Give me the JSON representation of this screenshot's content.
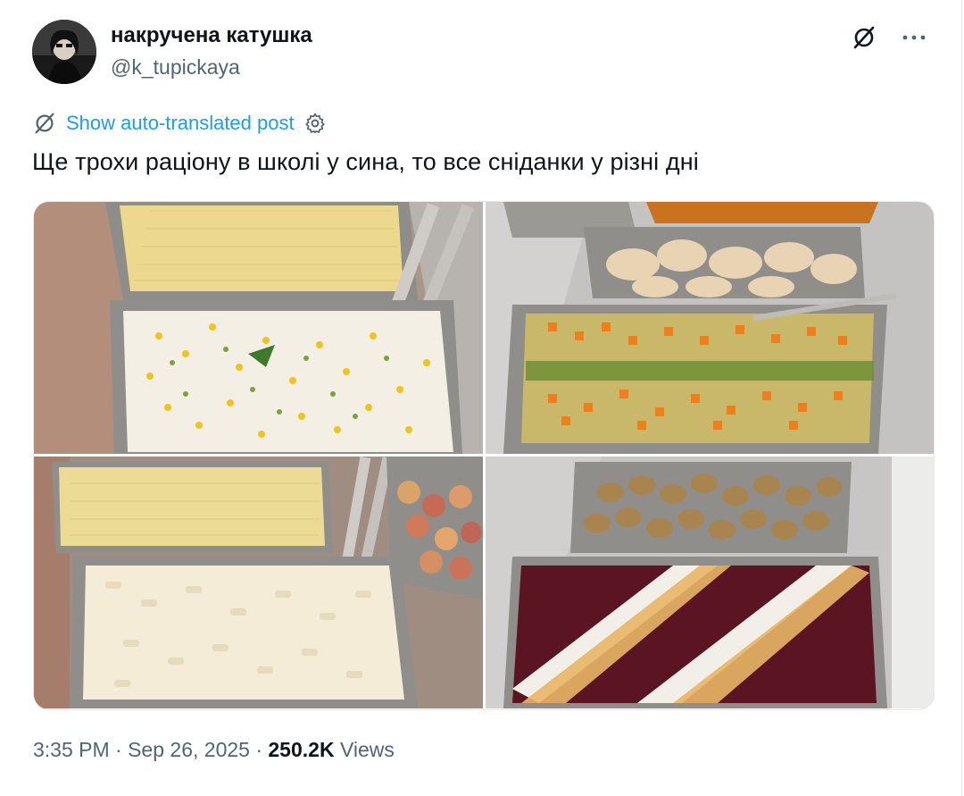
{
  "post": {
    "author": {
      "display_name": "накручена катушка",
      "handle": "@k_tupickaya",
      "avatar_icon": "profile-photo"
    },
    "translate_link": "Show auto-translated post",
    "text": "Ще трохи раціону в школі у сина, то все сніданки у різні дні",
    "media": [
      {
        "name": "photo-1",
        "description_icon": "food-tray-photo"
      },
      {
        "name": "photo-2",
        "description_icon": "food-tray-photo"
      },
      {
        "name": "photo-3",
        "description_icon": "food-tray-photo"
      },
      {
        "name": "photo-4",
        "description_icon": "food-tray-photo"
      }
    ],
    "timestamp": "3:35 PM · Sep 26, 2025 · ",
    "views_count": "250.2K",
    "views_label": " Views"
  },
  "colors": {
    "link": "#1d9bf0",
    "secondary_text": "#536471",
    "primary_text": "#0f1419"
  }
}
